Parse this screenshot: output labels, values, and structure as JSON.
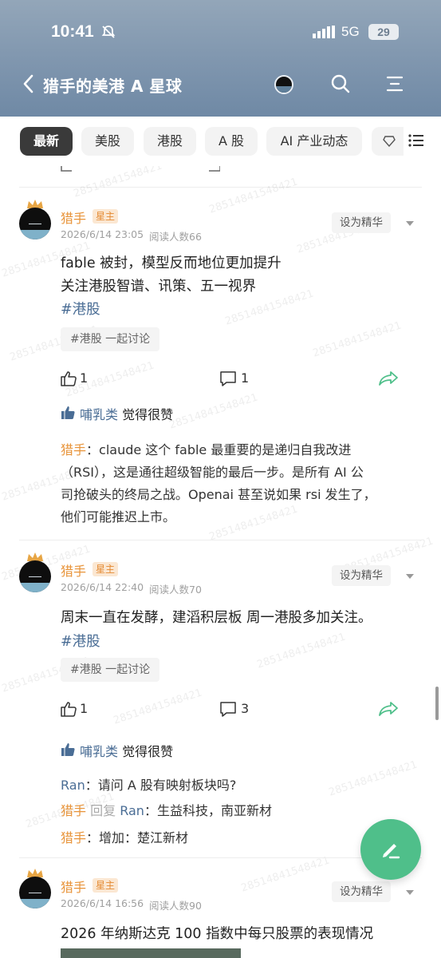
{
  "status": {
    "time": "10:41",
    "network": "5G",
    "battery": "29"
  },
  "header": {
    "title": "猎手的美港 A 星球"
  },
  "tabs": [
    "最新",
    "美股",
    "港股",
    "A 股",
    "AI 产业动态"
  ],
  "colors": {
    "accent": "#4fbf8a",
    "author": "#e8943a",
    "link": "#4a6d95"
  },
  "watermark": "28514841548421",
  "posts": [
    {
      "author": "猎手",
      "badge": "星主",
      "date": "2026/6/14 23:05",
      "reads": "阅读人数66",
      "feature": "设为精华",
      "lines": [
        "fable 被封，模型反而地位更加提升",
        "关注港股智谱、讯策、五一视界"
      ],
      "tag": "#港股",
      "topic": "#港股 一起讨论",
      "likes": "1",
      "comments": "1",
      "liked_by": "哺乳类",
      "liked_suffix": "觉得很赞",
      "comments_list": [
        {
          "author": "猎手",
          "sep": "：",
          "lines": [
            "claude 这个 fable 最重要的是递归自我改进",
            "（RSI），这是通往超级智能的最后一步。是所有 AI 公",
            "司抢破头的终局之战。Openai 甚至说如果 rsi 发生了，",
            "他们可能推迟上市。"
          ]
        }
      ]
    },
    {
      "author": "猎手",
      "badge": "星主",
      "date": "2026/6/14 22:40",
      "reads": "阅读人数70",
      "feature": "设为精华",
      "lines": [
        "周末一直在发酵，建滔积层板 周一港股多加关注。"
      ],
      "tag": "#港股",
      "topic": "#港股 一起讨论",
      "likes": "1",
      "comments": "3",
      "liked_by": "哺乳类",
      "liked_suffix": "觉得很赞",
      "comments_list": [
        {
          "author": "Ran",
          "sep": "：",
          "text": "请问 A 股有映射板块吗?"
        },
        {
          "author": "猎手",
          "reply": "回复",
          "to": "Ran",
          "sep": "：",
          "text": "生益科技，南亚新材"
        },
        {
          "author": "猎手",
          "sep": "：",
          "text": "增加：楚江新材"
        }
      ]
    },
    {
      "author": "猎手",
      "badge": "星主",
      "date": "2026/6/14 16:56",
      "reads": "阅读人数90",
      "feature": "设为精华",
      "lines": [
        "2026 年纳斯达克 100 指数中每只股票的表现情况"
      ]
    }
  ]
}
